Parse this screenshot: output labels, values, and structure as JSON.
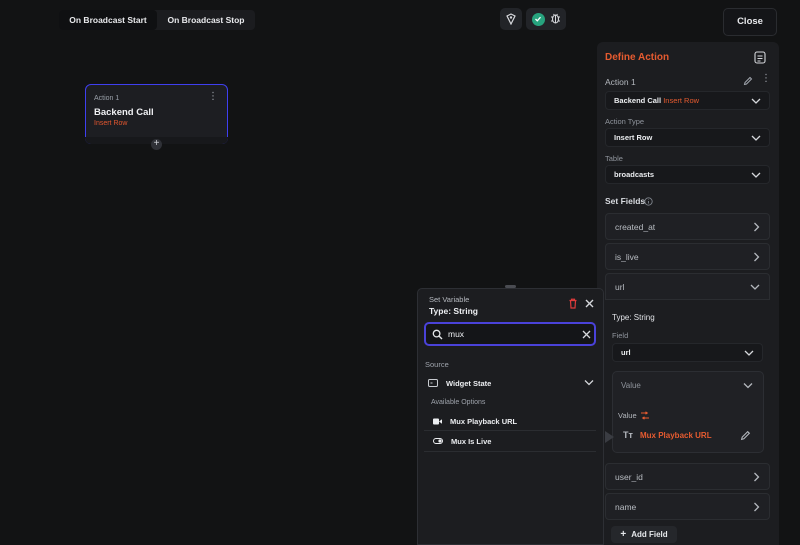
{
  "tabs": [
    "On Broadcast Start",
    "On Broadcast Stop"
  ],
  "close_label": "Close",
  "node": {
    "subtitle": "Action 1",
    "title": "Backend Call",
    "description": "Insert Row",
    "add": "+"
  },
  "panel": {
    "title": "Define Action",
    "action_label": "Action 1",
    "action_select": "Backend Call",
    "action_select_suffix": "Insert Row",
    "action_type_label": "Action Type",
    "action_type_value": "Insert Row",
    "table_label": "Table",
    "table_value": "broadcasts",
    "set_fields_label": "Set Fields",
    "fields": [
      "created_at",
      "is_live",
      "url",
      "user_id",
      "name"
    ],
    "url_expanded": {
      "type_label": "Type: String",
      "field_label": "Field",
      "field_value": "url",
      "value_header": "Value",
      "value_label": "Value",
      "value_source": "Mux Playback URL"
    },
    "add_field": "Add Field"
  },
  "popup": {
    "title": "Set Variable",
    "type": "Type: String",
    "search_value": "mux",
    "source_label": "Source",
    "source_value": "Widget State",
    "available_label": "Available Options",
    "options": [
      "Mux Playback URL",
      "Mux Is Live"
    ]
  },
  "colors": {
    "accent": "#e65b30",
    "focus": "#4a42d9",
    "success": "#27a37e"
  }
}
